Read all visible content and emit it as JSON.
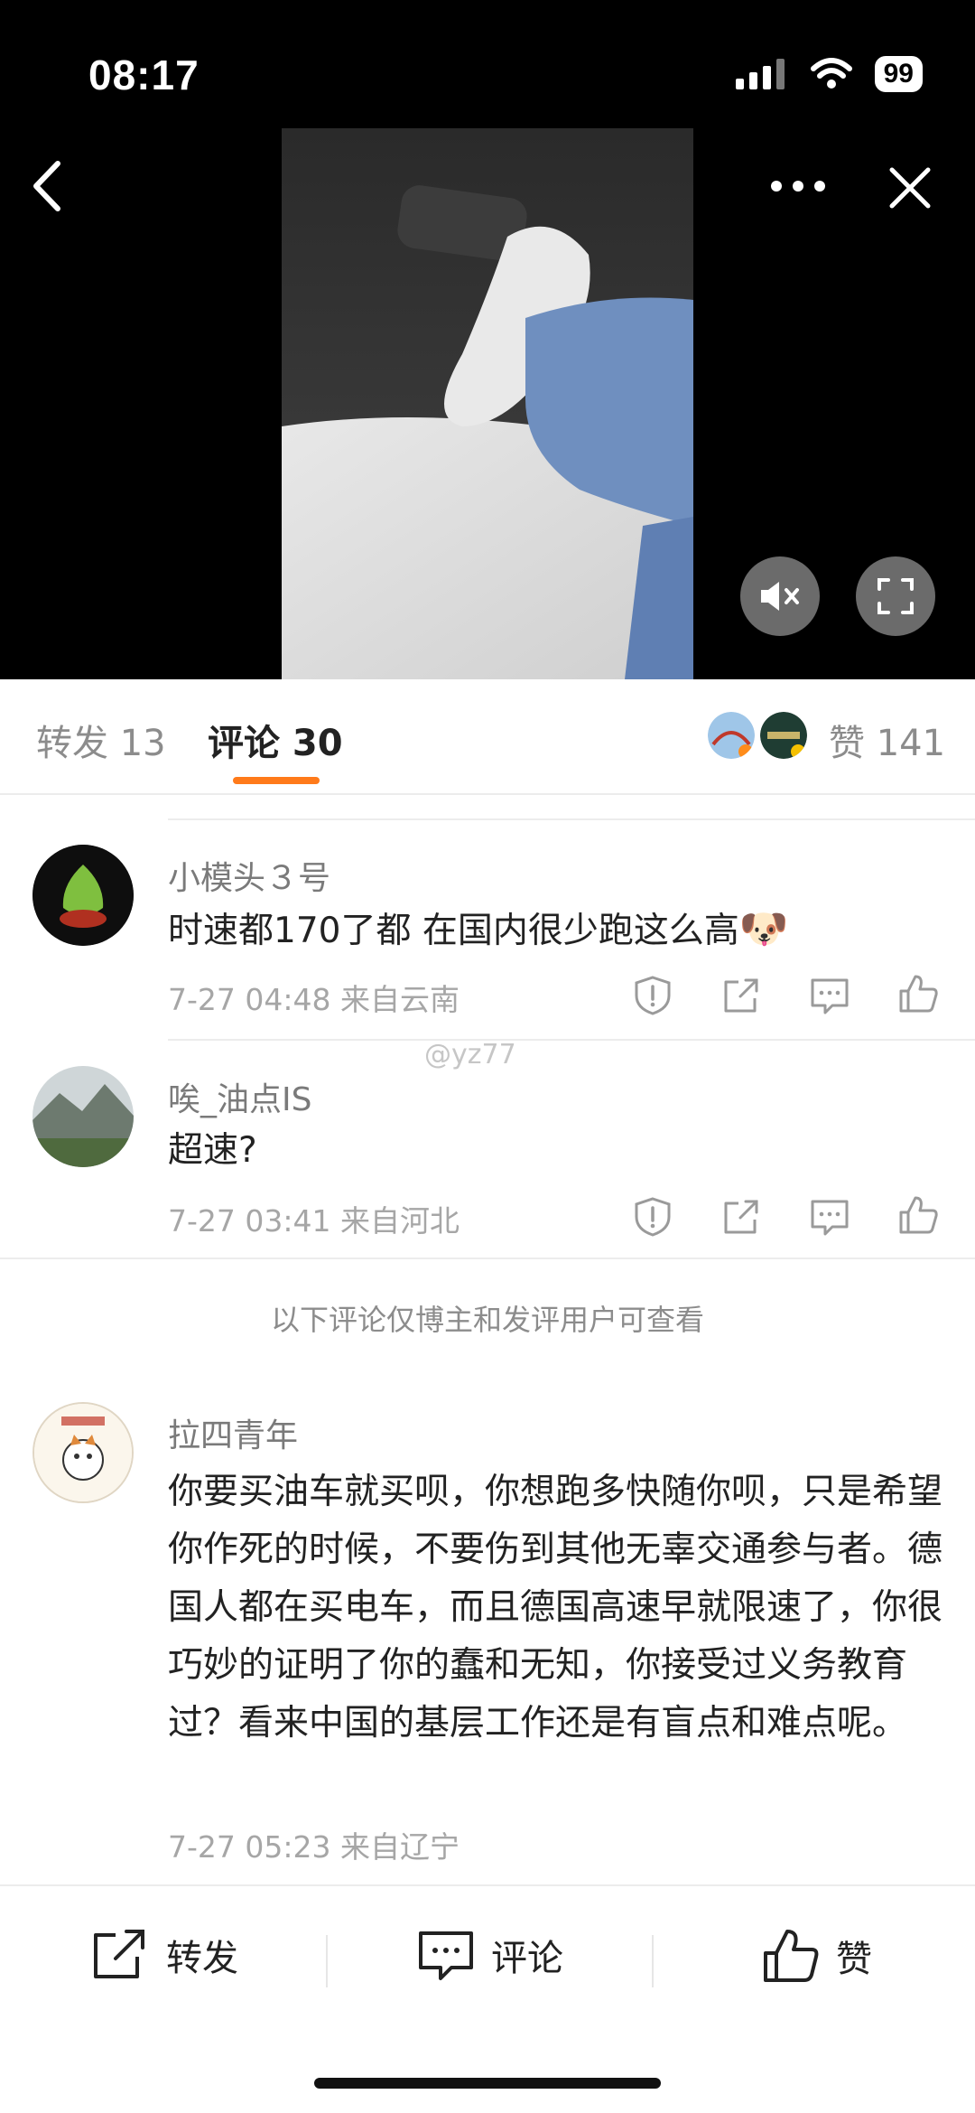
{
  "status_bar": {
    "time": "08:17",
    "battery": "99"
  },
  "tabs": {
    "repost": "转发 13",
    "comments": "评论 30",
    "likes": "赞 141"
  },
  "comments": [
    {
      "name": "小模头３号",
      "text": "时速都170了都 在国内很少跑这么高",
      "emoji": "🐶",
      "meta": "7-27 04:48 来自云南"
    },
    {
      "name": "唉_油点IS",
      "text": "超速?",
      "meta": "7-27 03:41 来自河北"
    },
    {
      "name": "拉四青年",
      "text": "你要买油车就买呗，你想跑多快随你呗，只是希望你作死的时候，不要伤到其他无辜交通参与者。德国人都在买电车，而且德国高速早就限速了，你很巧妙的证明了你的蠢和无知，你接受过义务教育过？看来中国的基层工作还是有盲点和难点呢。",
      "meta": "7-27 05:23 来自辽宁"
    }
  ],
  "watermark": "@yz77",
  "notice": "以下评论仅博主和发评用户可查看",
  "bottom_bar": {
    "repost": "转发",
    "comment": "评论",
    "like": "赞"
  }
}
